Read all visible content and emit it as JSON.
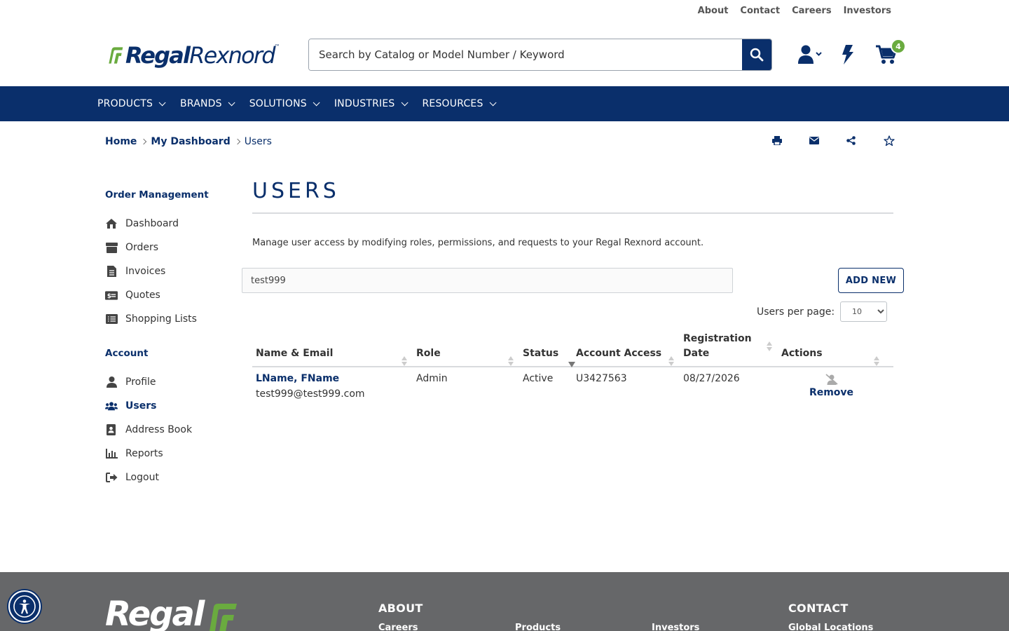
{
  "utility_nav": [
    "About",
    "Contact",
    "Careers",
    "Investors"
  ],
  "brand": {
    "bold": "Regal",
    "light": "Rexnord"
  },
  "search": {
    "placeholder": "Search by Catalog or Model Number / Keyword"
  },
  "header": {
    "cart_count": "4",
    "icons": [
      "user-icon",
      "bolt-icon",
      "cart-icon"
    ]
  },
  "nav": [
    "PRODUCTS",
    "BRANDS",
    "SOLUTIONS",
    "INDUSTRIES",
    "RESOURCES"
  ],
  "breadcrumb": {
    "home": "Home",
    "dashboard": "My Dashboard",
    "current": "Users"
  },
  "sidebar": {
    "order_heading": "Order Management",
    "order_items": [
      {
        "label": "Dashboard",
        "icon": "dashboard-icon"
      },
      {
        "label": "Orders",
        "icon": "orders-icon"
      },
      {
        "label": "Invoices",
        "icon": "invoice-icon"
      },
      {
        "label": "Quotes",
        "icon": "quotes-icon"
      },
      {
        "label": "Shopping Lists",
        "icon": "list-icon"
      }
    ],
    "account_heading": "Account",
    "account_items": [
      {
        "label": "Profile",
        "icon": "user-icon"
      },
      {
        "label": "Users",
        "icon": "users-icon",
        "active": true
      },
      {
        "label": "Address Book",
        "icon": "address-book-icon"
      },
      {
        "label": "Reports",
        "icon": "reports-icon"
      },
      {
        "label": "Logout",
        "icon": "logout-icon"
      }
    ]
  },
  "main": {
    "title": "USERS",
    "intro": "Manage user access by modifying roles, permissions, and requests to your Regal Rexnord account.",
    "filter_value": "test999",
    "add_new": "ADD NEW",
    "per_page_label": "Users per page:",
    "per_page_value": "10"
  },
  "table": {
    "headers": [
      "Name & Email",
      "Role",
      "Status",
      "Account Access",
      "Registration Date",
      "Actions"
    ],
    "rows": [
      {
        "name": "LName, FName",
        "email": "test999@test999.com",
        "role": "Admin",
        "status": "Active",
        "account": "U3427563",
        "registered": "08/27/2026",
        "action": "Remove"
      }
    ]
  },
  "footer": {
    "brand": "Regal",
    "about_heading": "ABOUT",
    "about_links": [
      "Careers",
      "Products",
      "Investors"
    ],
    "contact_heading": "CONTACT",
    "contact_links": [
      "Global Locations"
    ]
  },
  "colors": {
    "navy": "#0a2f6b",
    "green": "#6aab3f",
    "footer": "#666769"
  }
}
